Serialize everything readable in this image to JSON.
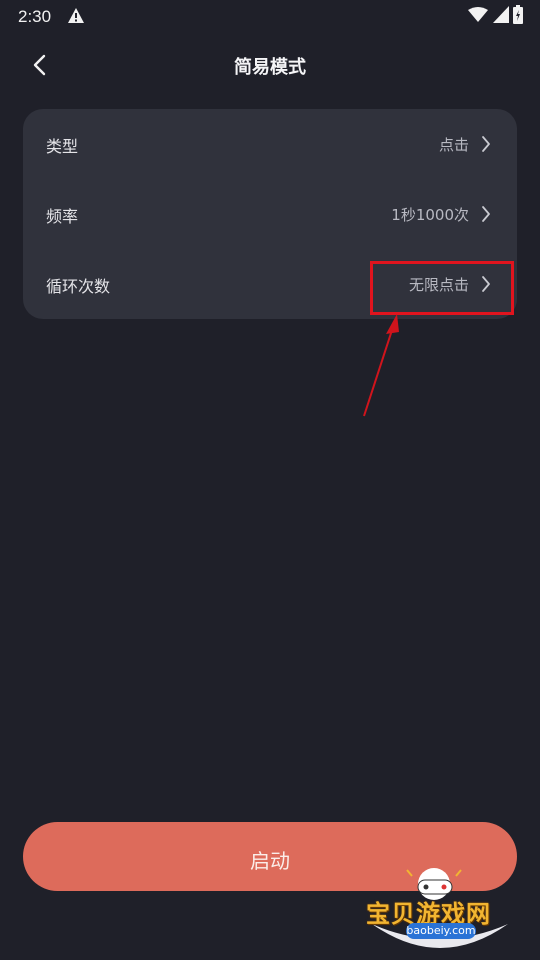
{
  "status_bar": {
    "time": "2:30",
    "icons": [
      "warning-icon",
      "wifi-icon",
      "signal-icon",
      "battery-icon"
    ]
  },
  "header": {
    "title": "简易模式",
    "back_icon": "chevron-left-icon"
  },
  "settings": {
    "rows": [
      {
        "label": "类型",
        "value": "点击"
      },
      {
        "label": "频率",
        "value": "1秒1000次"
      },
      {
        "label": "循环次数",
        "value": "无限点击"
      }
    ],
    "chevron_icon": "chevron-right-icon"
  },
  "annotation": {
    "highlight_color": "#e0141e",
    "target": "循环次数"
  },
  "footer": {
    "start_label": "启动",
    "accent_color": "#dd6b5b"
  },
  "watermark": {
    "text": "宝贝游戏网",
    "url": "baobeiy.com"
  }
}
